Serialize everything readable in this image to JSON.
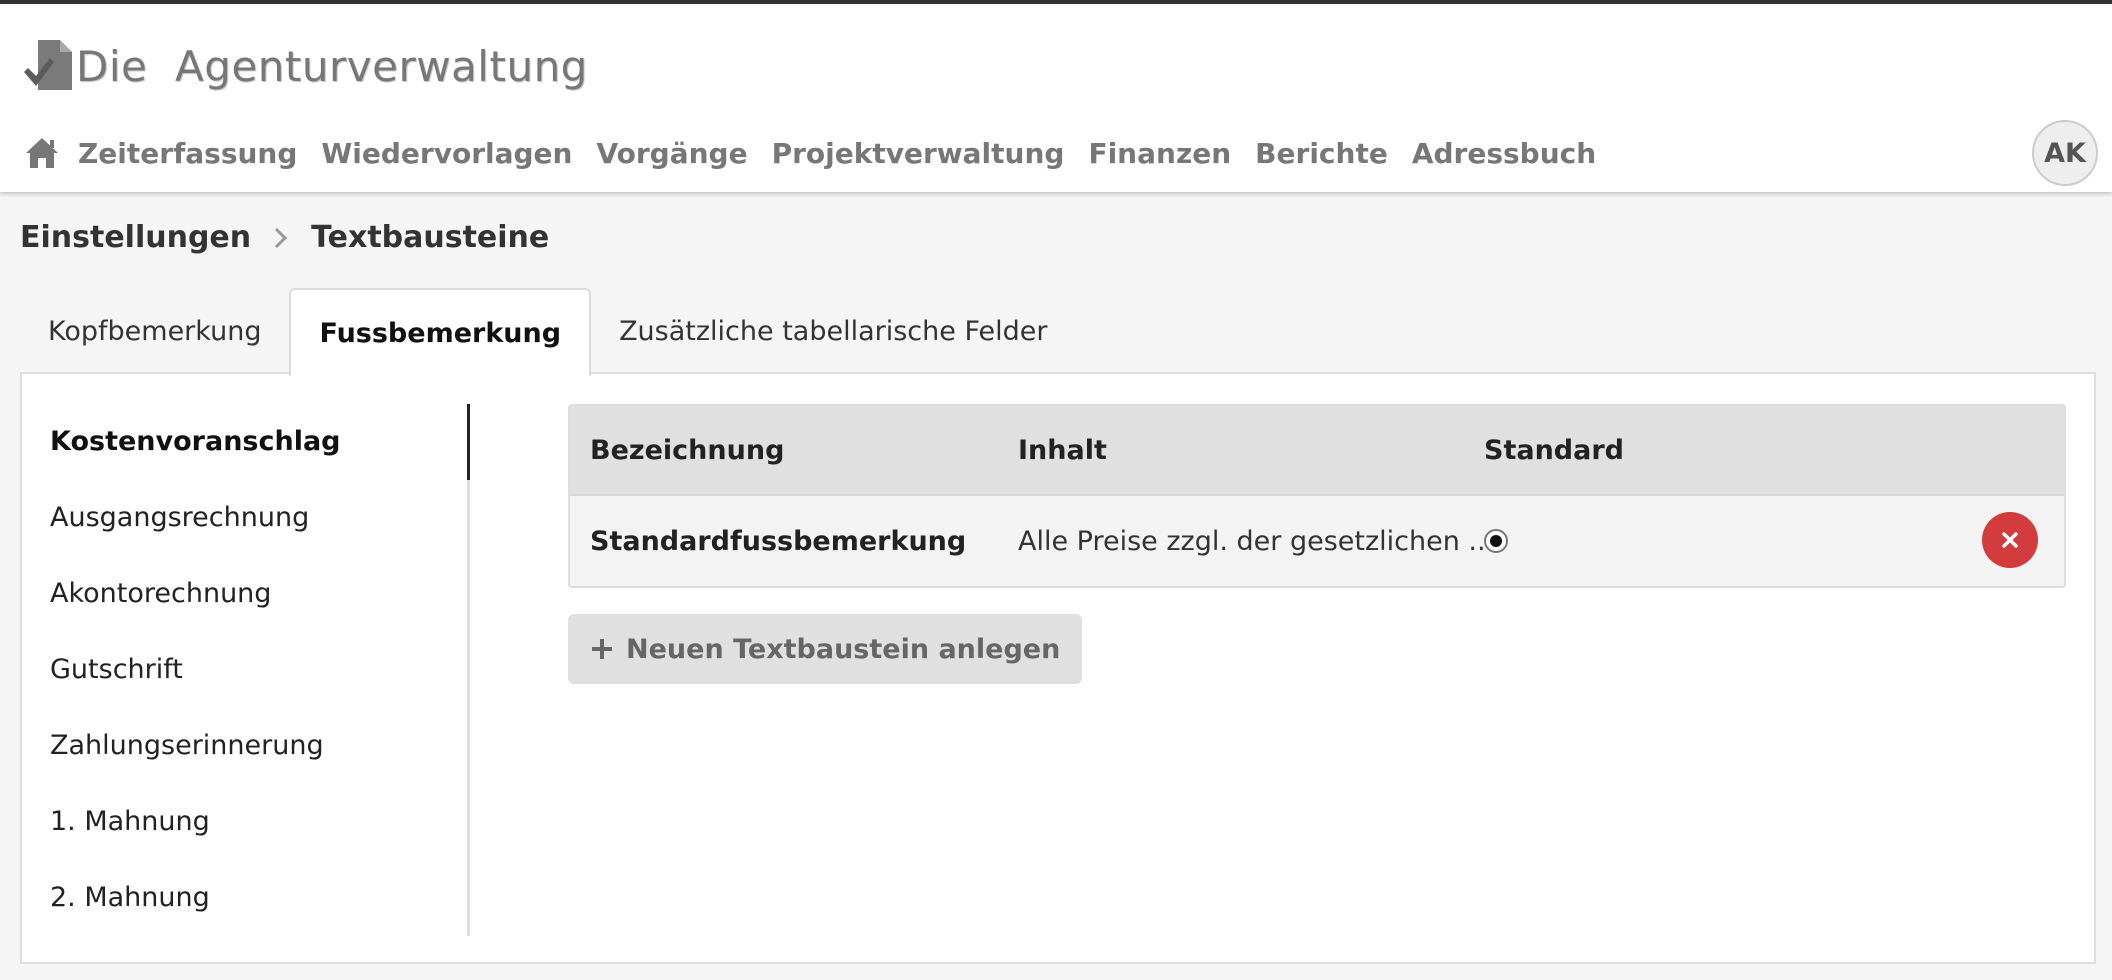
{
  "app": {
    "logo_text": "Die  Agenturverwaltung",
    "logo_icon": "document-logo-icon"
  },
  "nav": {
    "home_icon": "home-icon",
    "items": [
      {
        "label": "Zeiterfassung"
      },
      {
        "label": "Wiedervorlagen"
      },
      {
        "label": "Vorgänge"
      },
      {
        "label": "Projektverwaltung"
      },
      {
        "label": "Finanzen"
      },
      {
        "label": "Berichte"
      },
      {
        "label": "Adressbuch"
      }
    ],
    "avatar_initials": "AK"
  },
  "breadcrumb": {
    "parent": "Einstellungen",
    "current": "Textbausteine",
    "separator_icon": "chevron-right-icon"
  },
  "tabs": [
    {
      "label": "Kopfbemerkung",
      "active": false
    },
    {
      "label": "Fussbemerkung",
      "active": true
    },
    {
      "label": "Zusätzliche tabellarische Felder",
      "active": false
    }
  ],
  "subnav": {
    "items": [
      {
        "label": "Kostenvoranschlag",
        "active": true
      },
      {
        "label": "Ausgangsrechnung",
        "active": false
      },
      {
        "label": "Akontorechnung",
        "active": false
      },
      {
        "label": "Gutschrift",
        "active": false
      },
      {
        "label": "Zahlungserinnerung",
        "active": false
      },
      {
        "label": "1. Mahnung",
        "active": false
      },
      {
        "label": "2. Mahnung",
        "active": false
      }
    ]
  },
  "table": {
    "headers": [
      "Bezeichnung",
      "Inhalt",
      "Standard"
    ],
    "rows": [
      {
        "bezeichnung": "Standardfussbemerkung",
        "inhalt": "Alle Preise zzgl. der gesetzlichen ...",
        "standard": true
      }
    ]
  },
  "actions": {
    "add_label": "Neuen Textbaustein anlegen",
    "delete_icon": "close-icon",
    "add_icon": "plus-icon"
  },
  "colors": {
    "delete_button": "#d33c3c",
    "nav_text": "#777777",
    "topbar_border": "#333333"
  }
}
